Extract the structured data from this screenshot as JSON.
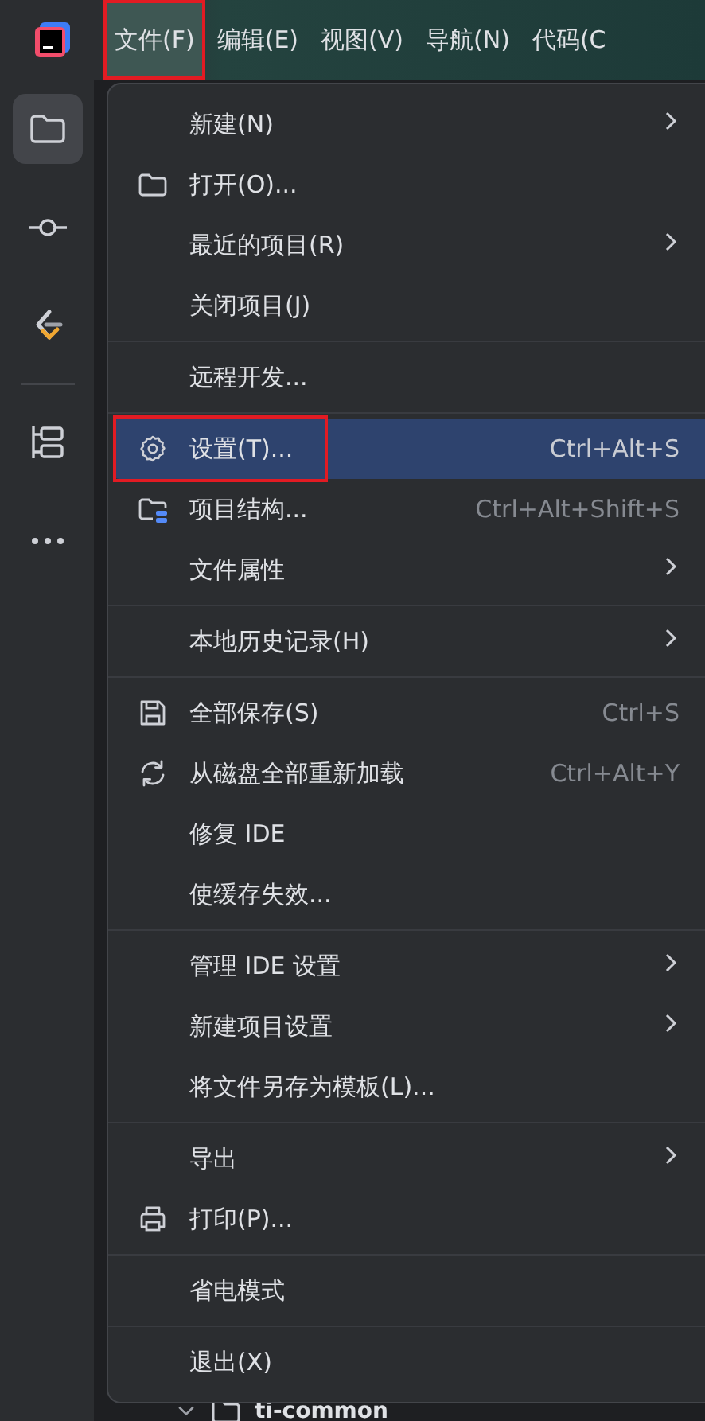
{
  "menubar": [
    {
      "label": "文件(F)",
      "selected": true,
      "annotated": true
    },
    {
      "label": "编辑(E)",
      "selected": false,
      "annotated": false
    },
    {
      "label": "视图(V)",
      "selected": false,
      "annotated": false
    },
    {
      "label": "导航(N)",
      "selected": false,
      "annotated": false
    },
    {
      "label": "代码(C",
      "selected": false,
      "annotated": false
    }
  ],
  "tool_groups": [
    [
      {
        "kind": "folder",
        "selected": true
      },
      {
        "kind": "commit",
        "selected": false
      },
      {
        "kind": "plugin",
        "selected": false
      }
    ],
    [
      {
        "kind": "structure",
        "selected": false
      },
      {
        "kind": "more",
        "selected": false
      }
    ]
  ],
  "menu": {
    "sections": [
      [
        {
          "label": "新建(N)",
          "kind": "plain",
          "submenu": true,
          "selected": false,
          "annotated": false
        },
        {
          "label": "打开(O)...",
          "kind": "folder",
          "submenu": false,
          "selected": false,
          "annotated": false
        },
        {
          "label": "最近的项目(R)",
          "kind": "plain",
          "submenu": true,
          "selected": false,
          "annotated": false
        },
        {
          "label": "关闭项目(J)",
          "kind": "plain",
          "submenu": false,
          "selected": false,
          "annotated": false
        }
      ],
      [
        {
          "label": "远程开发...",
          "kind": "plain",
          "submenu": false,
          "selected": false,
          "annotated": false
        }
      ],
      [
        {
          "label": "设置(T)...",
          "shortcut": "Ctrl+Alt+S",
          "kind": "gear",
          "submenu": false,
          "selected": true,
          "annotated": true
        },
        {
          "label": "项目结构...",
          "shortcut": "Ctrl+Alt+Shift+S",
          "kind": "project",
          "submenu": false,
          "selected": false,
          "annotated": false
        },
        {
          "label": "文件属性",
          "kind": "plain",
          "submenu": true,
          "selected": false,
          "annotated": false
        }
      ],
      [
        {
          "label": "本地历史记录(H)",
          "kind": "plain",
          "submenu": true,
          "selected": false,
          "annotated": false
        }
      ],
      [
        {
          "label": "全部保存(S)",
          "shortcut": "Ctrl+S",
          "kind": "save",
          "submenu": false,
          "selected": false,
          "annotated": false
        },
        {
          "label": "从磁盘全部重新加载",
          "shortcut": "Ctrl+Alt+Y",
          "kind": "reload",
          "submenu": false,
          "selected": false,
          "annotated": false
        },
        {
          "label": "修复 IDE",
          "kind": "plain",
          "submenu": false,
          "selected": false,
          "annotated": false
        },
        {
          "label": "使缓存失效...",
          "kind": "plain",
          "submenu": false,
          "selected": false,
          "annotated": false
        }
      ],
      [
        {
          "label": "管理 IDE 设置",
          "kind": "plain",
          "submenu": true,
          "selected": false,
          "annotated": false
        },
        {
          "label": "新建项目设置",
          "kind": "plain",
          "submenu": true,
          "selected": false,
          "annotated": false
        },
        {
          "label": "将文件另存为模板(L)...",
          "kind": "plain",
          "submenu": false,
          "selected": false,
          "annotated": false
        }
      ],
      [
        {
          "label": "导出",
          "kind": "plain",
          "submenu": true,
          "selected": false,
          "annotated": false
        },
        {
          "label": "打印(P)...",
          "kind": "print",
          "submenu": false,
          "selected": false,
          "annotated": false
        }
      ],
      [
        {
          "label": "省电模式",
          "kind": "plain",
          "submenu": false,
          "selected": false,
          "annotated": false
        }
      ],
      [
        {
          "label": "退出(X)",
          "kind": "plain",
          "submenu": false,
          "selected": false,
          "annotated": false
        }
      ]
    ]
  },
  "tree_row": {
    "label": "ti-common",
    "expanded": true
  }
}
